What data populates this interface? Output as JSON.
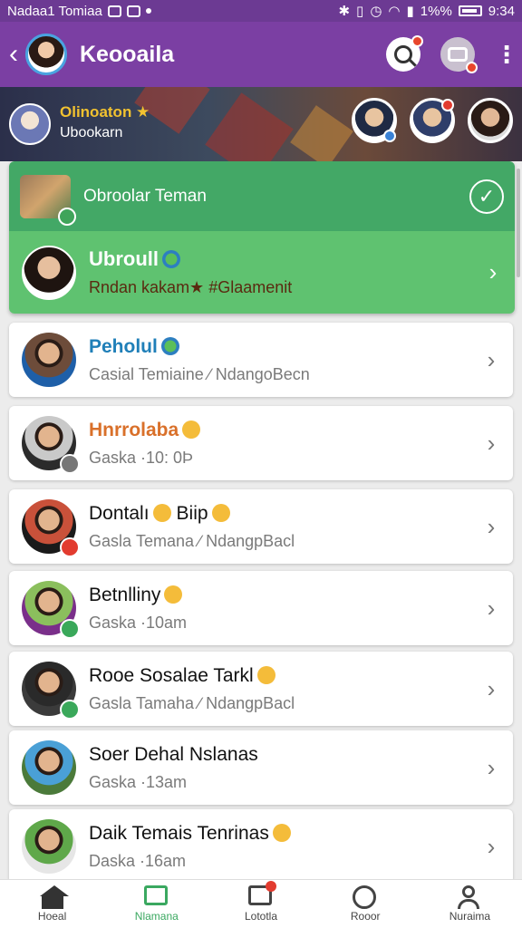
{
  "status_bar": {
    "carrier": "Nadaa1 Tomiaa",
    "battery_text": "1%%",
    "time": "9:34"
  },
  "app_bar": {
    "title": "Keooaila",
    "search_icon": "search-icon",
    "camera_icon": "camera-icon",
    "more_icon": "more-vertical-icon"
  },
  "banner": {
    "title": "Olinoaton ★",
    "subtitle": "Ubookarn"
  },
  "featured": {
    "group_label": "Obroolar Teman",
    "name": "Ubroull",
    "message": "Rndan kakam★ #Glaamenit"
  },
  "chats": [
    {
      "name": "Peholul",
      "message": "Casial Temiaine ∕ NdangoBecn",
      "style": "blue",
      "emoji": "globe",
      "avatar_bg": "#6d4c3a",
      "shirt": "#1e5fa8",
      "dot": null
    },
    {
      "name": "Hnrrolaba",
      "message": "Gaska ·10: 0Ϸ",
      "style": "orange",
      "emoji": "sun",
      "avatar_bg": "#c9c9c9",
      "shirt": "#2b2b2b",
      "dot": "#777777"
    },
    {
      "name": "Dontalı",
      "name_extra": "Biip",
      "message": "Gaslа Temana ∕ NdangpBacl",
      "style": "",
      "emoji": "face",
      "avatar_bg": "#c9513a",
      "shirt": "#1a1a1a",
      "dot": "#e23b2f"
    },
    {
      "name": "Betnlliny",
      "message": "Gaska ·10am",
      "style": "",
      "emoji": "face",
      "avatar_bg": "#8bbf5d",
      "shirt": "#7a2f8a",
      "dot": "#3aa85a"
    },
    {
      "name": "Rooe Sosalae Tarkl",
      "message": "Gaslа Tamaha ∕ NdangpBacl",
      "style": "",
      "emoji": "face",
      "avatar_bg": "#2a2a2a",
      "shirt": "#3b3b3b",
      "dot": "#3aa85a"
    },
    {
      "name": "Soer Dehal Nslanas",
      "message": "Gaska ·13am",
      "style": "",
      "emoji": null,
      "avatar_bg": "#4aa0d6",
      "shirt": "#4b7a3a",
      "dot": null
    },
    {
      "name": "Daik Temais Tenrinas",
      "message": "Daska ·16am",
      "style": "",
      "emoji": "face",
      "avatar_bg": "#5fa84a",
      "shirt": "#e6e6e6",
      "dot": null
    }
  ],
  "bottom_nav": [
    {
      "label": "Hoeal",
      "icon": "home-icon",
      "active": false
    },
    {
      "label": "Nlamana",
      "icon": "chat-icon",
      "active": true
    },
    {
      "label": "Lototla",
      "icon": "calendar-icon",
      "active": false
    },
    {
      "label": "Rooor",
      "icon": "smile-icon",
      "active": false
    },
    {
      "label": "Nuraima",
      "icon": "profile-icon",
      "active": false
    }
  ]
}
